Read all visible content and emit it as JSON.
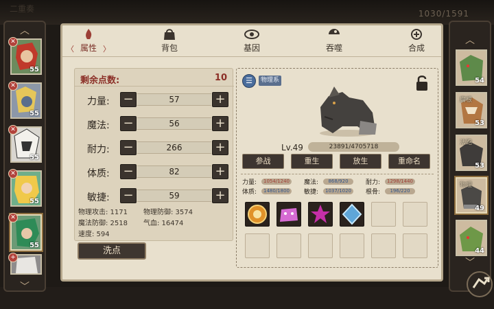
{
  "header": {
    "faded_left": "二重奏",
    "resource": "1030/1591"
  },
  "tabs": [
    {
      "label": "属性",
      "icon": "flame-icon"
    },
    {
      "label": "背包",
      "icon": "bag-icon"
    },
    {
      "label": "基因",
      "icon": "gene-icon"
    },
    {
      "label": "吞噬",
      "icon": "devour-icon"
    },
    {
      "label": "合成",
      "icon": "synthesis-icon"
    }
  ],
  "left_roster": [
    {
      "level": "55",
      "badge": "✕"
    },
    {
      "level": "55",
      "badge": "✕"
    },
    {
      "level": "55",
      "badge": "✕"
    },
    {
      "level": "55",
      "badge": "✕"
    },
    {
      "level": "55",
      "badge": "✕"
    },
    {
      "level": "",
      "badge": "+"
    }
  ],
  "right_roster": [
    {
      "level": "54",
      "name": ""
    },
    {
      "level": "53",
      "name": "腐根"
    },
    {
      "level": "53",
      "name": "法跑"
    },
    {
      "level": "49",
      "name": "物理"
    },
    {
      "level": "44",
      "name": ""
    }
  ],
  "attributes": {
    "remaining_label": "剩余点数:",
    "remaining_value": "10",
    "stats": [
      {
        "name": "力量:",
        "value": "57"
      },
      {
        "name": "魔法:",
        "value": "56"
      },
      {
        "name": "耐力:",
        "value": "266"
      },
      {
        "name": "体质:",
        "value": "82"
      },
      {
        "name": "敏捷:",
        "value": "59"
      }
    ],
    "derived": {
      "phys_atk": "物理攻击: 1171",
      "phys_def": "物理防御: 3574",
      "magic_def": "魔法防御: 2518",
      "hp": "气血: 16474",
      "speed": "速度: 594"
    },
    "wash_button": "洗点"
  },
  "pet": {
    "type_label": "物理系",
    "level": "Lv.49",
    "exp": "23891/4705718",
    "exp_fraction": 0.005,
    "buttons": [
      "参战",
      "重生",
      "放生",
      "重命名"
    ],
    "stats": [
      {
        "label": "力量:",
        "value": "1054/1240"
      },
      {
        "label": "魔法:",
        "value": "868/920"
      },
      {
        "label": "耐力:",
        "value": "1298/1440"
      },
      {
        "label": "体质:",
        "value": "1480/1800"
      },
      {
        "label": "敏捷:",
        "value": "1037/1020"
      },
      {
        "label": "根骨:",
        "value": "196/220"
      }
    ],
    "skills": [
      "sun-skill-icon",
      "pink-beast-skill-icon",
      "magenta-star-skill-icon",
      "ice-crystal-skill-icon"
    ]
  },
  "colors": {
    "accent_red": "#8b2e26",
    "panel": "#e8e0cd",
    "dark_button": "#3b342e"
  }
}
